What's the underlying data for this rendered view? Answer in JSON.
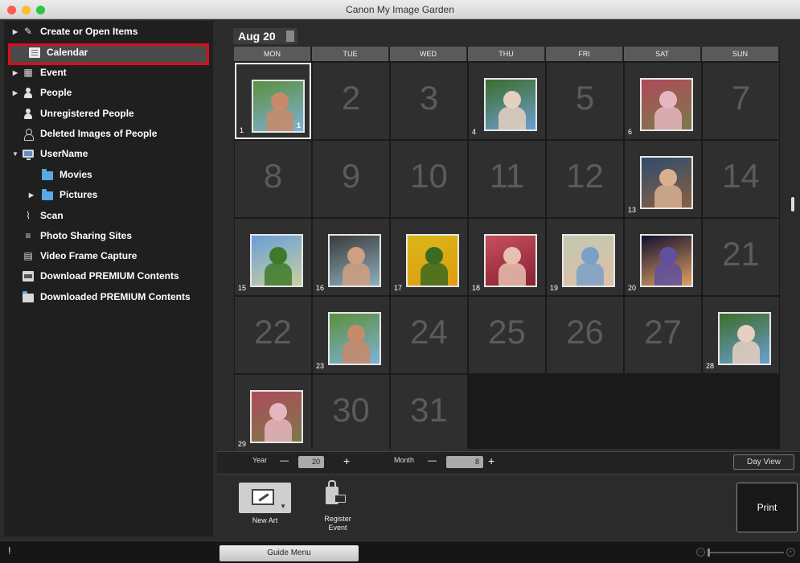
{
  "window": {
    "title": "Canon My Image Garden"
  },
  "sidebar": {
    "items": [
      {
        "label": "Create or Open Items",
        "icon": "create-items-icon"
      },
      {
        "label": "Calendar",
        "icon": "calendar-icon"
      },
      {
        "label": "Event",
        "icon": "event-icon"
      },
      {
        "label": "People",
        "icon": "people-icon"
      },
      {
        "label": "Unregistered People",
        "icon": "unregistered-people-icon"
      },
      {
        "label": "Deleted Images of People",
        "icon": "deleted-people-icon"
      },
      {
        "label": "UserName",
        "icon": "computer-icon"
      },
      {
        "label": "Movies",
        "icon": "folder-icon"
      },
      {
        "label": "Pictures",
        "icon": "folder-icon"
      },
      {
        "label": "Scan",
        "icon": "scan-icon"
      },
      {
        "label": "Photo Sharing Sites",
        "icon": "photo-sharing-icon"
      },
      {
        "label": "Video Frame Capture",
        "icon": "video-frame-icon"
      },
      {
        "label": "Download PREMIUM Contents",
        "icon": "download-icon"
      },
      {
        "label": "Downloaded PREMIUM Contents",
        "icon": "downloaded-folder-icon"
      }
    ]
  },
  "calendar": {
    "month_label": "Aug 20",
    "weekdays": [
      "MON",
      "TUE",
      "WED",
      "THU",
      "FRI",
      "SAT",
      "SUN"
    ],
    "days": [
      {
        "day": "1",
        "photo": true,
        "badge": "1"
      },
      {
        "day": "2",
        "photo": false
      },
      {
        "day": "3",
        "photo": false
      },
      {
        "day": "4",
        "photo": true
      },
      {
        "day": "5",
        "photo": false
      },
      {
        "day": "6",
        "photo": true
      },
      {
        "day": "7",
        "photo": false
      },
      {
        "day": "8",
        "photo": false
      },
      {
        "day": "9",
        "photo": false
      },
      {
        "day": "10",
        "photo": false
      },
      {
        "day": "11",
        "photo": false
      },
      {
        "day": "12",
        "photo": false
      },
      {
        "day": "13",
        "photo": true
      },
      {
        "day": "14",
        "photo": false
      },
      {
        "day": "15",
        "photo": true
      },
      {
        "day": "16",
        "photo": true
      },
      {
        "day": "17",
        "photo": true
      },
      {
        "day": "18",
        "photo": true
      },
      {
        "day": "19",
        "photo": true
      },
      {
        "day": "20",
        "photo": true
      },
      {
        "day": "21",
        "photo": false
      },
      {
        "day": "22",
        "photo": false
      },
      {
        "day": "23",
        "photo": true
      },
      {
        "day": "24",
        "photo": false
      },
      {
        "day": "25",
        "photo": false
      },
      {
        "day": "26",
        "photo": false
      },
      {
        "day": "27",
        "photo": false
      },
      {
        "day": "28",
        "photo": true
      },
      {
        "day": "29",
        "photo": true
      },
      {
        "day": "30",
        "photo": false
      },
      {
        "day": "31",
        "photo": false
      }
    ]
  },
  "controls": {
    "year_label": "Year",
    "year_value": "20",
    "month_label": "Month",
    "month_value": "8",
    "minus": "—",
    "plus": "+",
    "day_view": "Day View"
  },
  "actions": {
    "new_art": "New Art",
    "register_event": "Register\nEvent",
    "print": "Print"
  },
  "bottom": {
    "guide_menu": "Guide Menu",
    "info_glyph": "ⵑ",
    "zoom_minus": "−",
    "zoom_plus": "+"
  },
  "colors": {
    "selection_outline": "#e30b17",
    "traffic_red": "#fd5c55",
    "traffic_yellow": "#febb2e",
    "traffic_green": "#2ac840"
  }
}
